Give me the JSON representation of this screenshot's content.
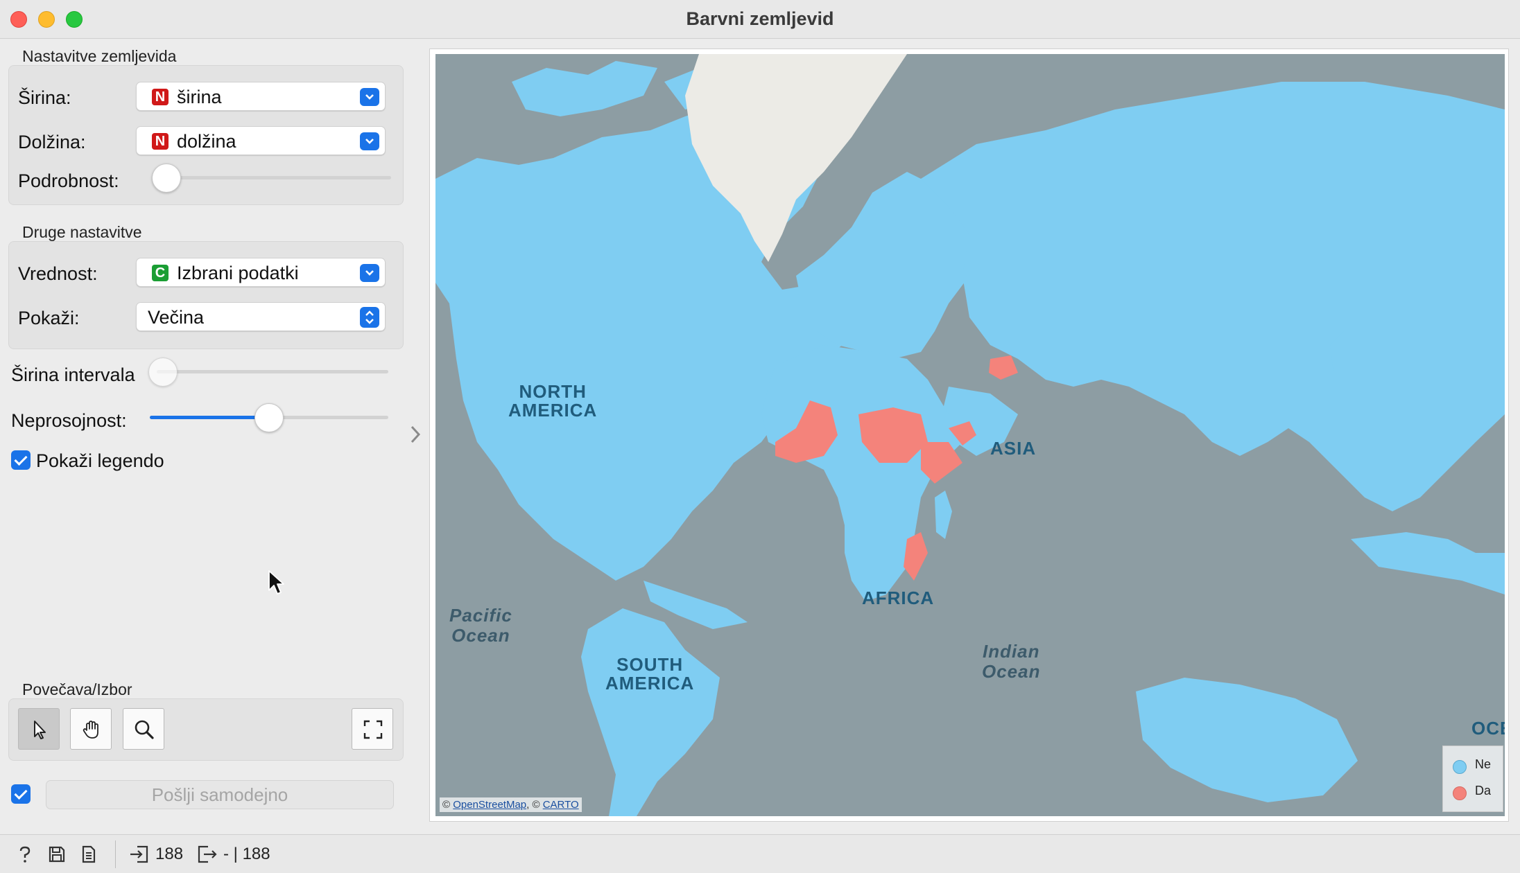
{
  "window": {
    "title": "Barvni zemljevid"
  },
  "map_settings": {
    "group_title": "Nastavitve zemljevida",
    "latitude_label": "Širina:",
    "latitude_value": "širina",
    "latitude_badge": "N",
    "longitude_label": "Dolžina:",
    "longitude_value": "dolžina",
    "longitude_badge": "N",
    "detail_label": "Podrobnost:",
    "detail_level": 0
  },
  "other_settings": {
    "group_title": "Druge nastavitve",
    "value_label": "Vrednost:",
    "value_value": "Izbrani podatki",
    "value_badge": "C",
    "show_label": "Pokaži:",
    "show_value": "Večina"
  },
  "bin_width": {
    "label": "Širina intervala",
    "level": 0
  },
  "opacity": {
    "label": "Neprosojnost:",
    "level": 0.5
  },
  "show_legend": {
    "label": "Pokaži legendo",
    "checked": true
  },
  "zoom_select": {
    "group_title": "Povečava/Izbor",
    "tools": [
      "pointer-select-icon",
      "pan-hand-icon",
      "zoom-magnifier-icon",
      "fit-fullscreen-icon"
    ],
    "active_tool": "pointer-select-icon"
  },
  "send": {
    "auto_checked": true,
    "button_label": "Pošlji samodejno"
  },
  "map": {
    "continent_labels": {
      "north_america": "NORTH\nAMERICA",
      "south_america": "SOUTH\nAMERICA",
      "africa": "AFRICA",
      "asia": "ASIA",
      "oceania": "OCE"
    },
    "ocean_labels": {
      "pacific": "Pacific\nOcean",
      "indian": "Indian\nOcean"
    },
    "attribution_prefix": "©",
    "attribution_osm": "OpenStreetMap",
    "attribution_sep": ", ©",
    "attribution_carto": "CARTO",
    "legend": [
      {
        "label": "Ne",
        "color": "#7fcdf2"
      },
      {
        "label": "Da",
        "color": "#f4837b"
      }
    ],
    "colors": {
      "water": "#8d9da3",
      "land_no": "#7fcdf2",
      "land_yes": "#f4837b",
      "greenland": "#ecebe6"
    }
  },
  "statusbar": {
    "input_count": "188",
    "output_count": "- | 188"
  }
}
